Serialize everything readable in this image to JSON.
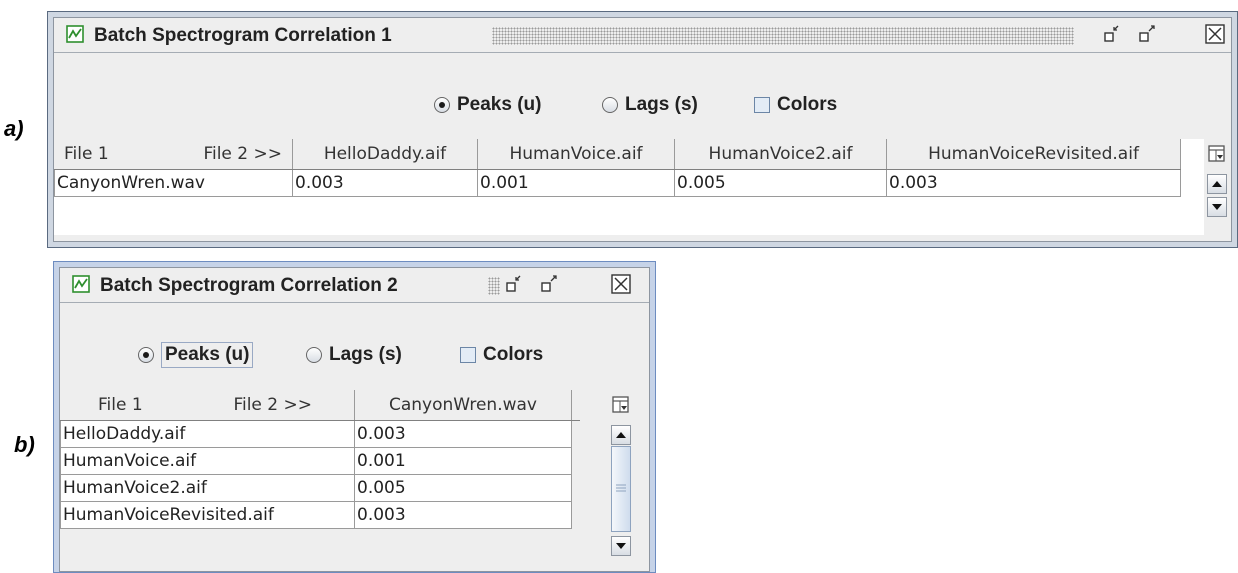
{
  "labels": {
    "a": "a)",
    "b": "b)"
  },
  "window1": {
    "title": "Batch Spectrogram Correlation 1",
    "options": {
      "peaks": "Peaks (u)",
      "lags": "Lags (s)",
      "colors": "Colors"
    },
    "selected": "peaks",
    "header": {
      "file1": "File 1",
      "file2": "File 2 >>"
    },
    "columns": [
      "HelloDaddy.aif",
      "HumanVoice.aif",
      "HumanVoice2.aif",
      "HumanVoiceRevisited.aif"
    ],
    "rows": [
      {
        "name": "CanyonWren.wav",
        "values": [
          "0.003",
          "0.001",
          "0.005",
          "0.003"
        ]
      }
    ]
  },
  "window2": {
    "title": "Batch Spectrogram Correlation 2",
    "options": {
      "peaks": "Peaks (u)",
      "lags": "Lags (s)",
      "colors": "Colors"
    },
    "selected": "peaks",
    "header": {
      "file1": "File 1",
      "file2": "File 2 >>"
    },
    "columns": [
      "CanyonWren.wav"
    ],
    "rows": [
      {
        "name": "HelloDaddy.aif",
        "value": "0.003"
      },
      {
        "name": "HumanVoice.aif",
        "value": "0.001"
      },
      {
        "name": "HumanVoice2.aif",
        "value": "0.005"
      },
      {
        "name": "HumanVoiceRevisited.aif",
        "value": "0.003"
      }
    ]
  },
  "icons": {
    "app": "chart-icon",
    "minimize": "minimize-icon",
    "maximize": "maximize-icon",
    "close": "close-icon",
    "column_control": "column-control-icon",
    "scroll_up": "arrow-up-icon",
    "scroll_down": "arrow-down-icon"
  },
  "colors": {
    "frame_border": "#cfd7e2",
    "panel_bg": "#eeeeee",
    "app_icon": "#2f8f2f"
  }
}
